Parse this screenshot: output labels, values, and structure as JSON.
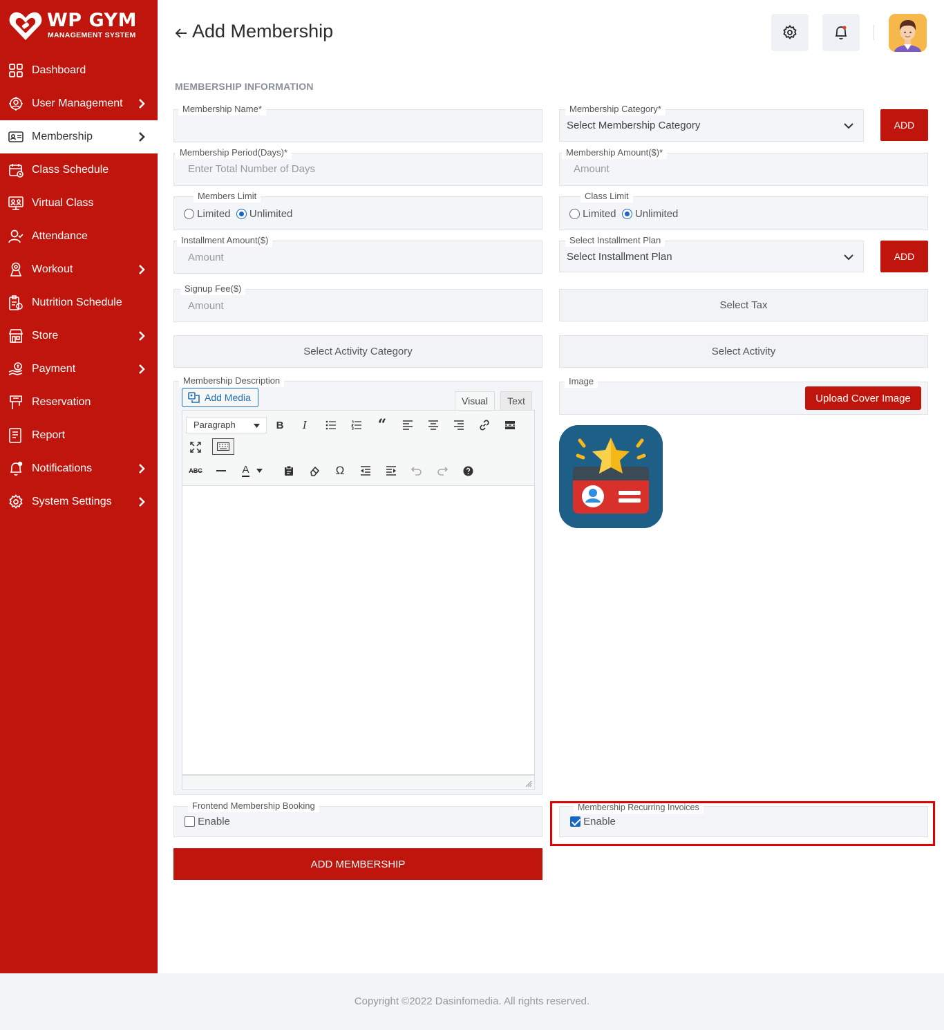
{
  "brand": {
    "title": "WP GYM",
    "subtitle": "MANAGEMENT SYSTEM"
  },
  "sidebar": {
    "items": [
      {
        "label": "Dashboard",
        "icon": "grid-icon",
        "has_submenu": false,
        "active": false
      },
      {
        "label": "User Management",
        "icon": "users-gear-icon",
        "has_submenu": true,
        "active": false
      },
      {
        "label": "Membership",
        "icon": "id-card-icon",
        "has_submenu": true,
        "active": true
      },
      {
        "label": "Class Schedule",
        "icon": "calendar-icon",
        "has_submenu": false,
        "active": false
      },
      {
        "label": "Virtual Class",
        "icon": "virtual-class-icon",
        "has_submenu": false,
        "active": false
      },
      {
        "label": "Attendance",
        "icon": "user-check-icon",
        "has_submenu": false,
        "active": false
      },
      {
        "label": "Workout",
        "icon": "workout-icon",
        "has_submenu": true,
        "active": false
      },
      {
        "label": "Nutrition Schedule",
        "icon": "nutrition-icon",
        "has_submenu": false,
        "active": false
      },
      {
        "label": "Store",
        "icon": "store-icon",
        "has_submenu": true,
        "active": false
      },
      {
        "label": "Payment",
        "icon": "payment-icon",
        "has_submenu": true,
        "active": false
      },
      {
        "label": "Reservation",
        "icon": "reservation-icon",
        "has_submenu": false,
        "active": false
      },
      {
        "label": "Report",
        "icon": "report-icon",
        "has_submenu": false,
        "active": false
      },
      {
        "label": "Notifications",
        "icon": "bell-icon",
        "has_submenu": true,
        "active": false
      },
      {
        "label": "System Settings",
        "icon": "gear-icon",
        "has_submenu": true,
        "active": false
      }
    ]
  },
  "header": {
    "title": "Add Membership"
  },
  "section": {
    "title": "MEMBERSHIP INFORMATION"
  },
  "form": {
    "membership_name": {
      "label": "Membership Name*",
      "value": ""
    },
    "membership_category": {
      "label": "Membership Category*",
      "value": "Select Membership Category",
      "add_label": "ADD"
    },
    "membership_period": {
      "label": "Membership Period(Days)*",
      "placeholder": "Enter Total Number of Days"
    },
    "membership_amount": {
      "label": "Membership Amount($)*",
      "placeholder": "Amount"
    },
    "members_limit": {
      "label": "Members Limit",
      "options": [
        "Limited",
        "Unlimited"
      ],
      "selected": "Unlimited"
    },
    "class_limit": {
      "label": "Class Limit",
      "options": [
        "Limited",
        "Unlimited"
      ],
      "selected": "Unlimited"
    },
    "installment_amount": {
      "label": "Installment Amount($)",
      "placeholder": "Amount"
    },
    "installment_plan": {
      "label": "Select Installment Plan",
      "value": "Select Installment Plan",
      "add_label": "ADD"
    },
    "signup_fee": {
      "label": "Signup Fee($)",
      "placeholder": "Amount"
    },
    "tax": {
      "value": "Select Tax"
    },
    "activity_category": {
      "value": "Select Activity Category"
    },
    "activity": {
      "value": "Select Activity"
    },
    "description": {
      "label": "Membership Description",
      "add_media": "Add Media",
      "tab_visual": "Visual",
      "tab_text": "Text",
      "format_select": "Paragraph"
    },
    "image": {
      "label": "Image",
      "upload_label": "Upload Cover Image"
    },
    "frontend_booking": {
      "label": "Frontend Membership Booking",
      "option": "Enable",
      "checked": false
    },
    "recurring_invoices": {
      "label": "Membership Recurring Invoices",
      "option": "Enable",
      "checked": true
    },
    "submit_label": "ADD MEMBERSHIP"
  },
  "footer": {
    "text": "Copyright ©2022 Dasinfomedia. All rights reserved."
  },
  "colors": {
    "brand_red": "#c0150c",
    "field_bg": "#f3f5f8",
    "highlight": "#e00000",
    "link_blue": "#2271b1"
  }
}
